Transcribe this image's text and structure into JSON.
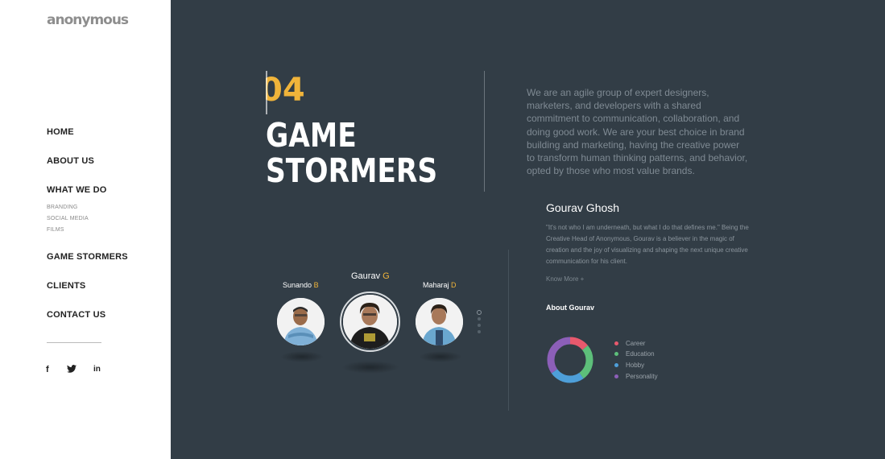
{
  "brand": {
    "logo": "anonymous"
  },
  "nav": {
    "home": "HOME",
    "about": "ABOUT US",
    "what_we_do": "WHAT WE DO",
    "sub": [
      "BRANDING",
      "SOCIAL MEDIA",
      "FILMS"
    ],
    "game_stormers": "GAME STORMERS",
    "clients": "CLIENTS",
    "contact": "CONTACT US"
  },
  "social": {
    "facebook": "f",
    "twitter": "twitter-icon",
    "linkedin": "in"
  },
  "section": {
    "number": "04",
    "title_line1": "GAME",
    "title_line2": "STORMERS",
    "intro": "We are an agile group of expert designers, marketers, and developers with a shared commitment to communication, collaboration, and doing good work. We are your best choice in brand building and marketing, having the creative power to transform human thinking patterns, and behavior, opted by those who most value brands."
  },
  "team": [
    {
      "first": "Sunando",
      "initial": "B"
    },
    {
      "first": "Gaurav",
      "initial": "G"
    },
    {
      "first": "Maharaj",
      "initial": "D"
    }
  ],
  "profile": {
    "name": "Gourav Ghosh",
    "quote": "\"It's not who I am underneath, but what I do that defines me.\" Being the Creative Head of Anonymous, Gourav is a believer in the magic of creation and the joy of visualizing and shaping the next unique creative communication for his client.",
    "know_more": "Know More +",
    "about_heading": "About Gourav"
  },
  "chart_data": {
    "type": "pie",
    "categories": [
      "Career",
      "Education",
      "Hobby",
      "Personality"
    ],
    "values": [
      14,
      26,
      25,
      35
    ],
    "colors": [
      "#e8596d",
      "#5dbf7a",
      "#4e9fd9",
      "#8c5fb8"
    ]
  }
}
